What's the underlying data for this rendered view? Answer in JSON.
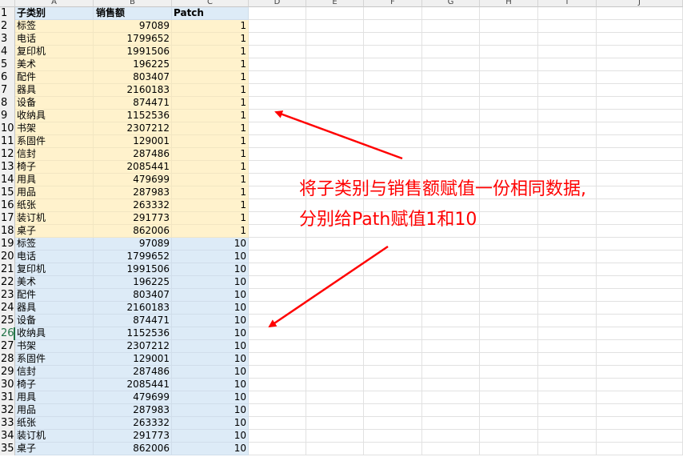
{
  "columns": [
    "A",
    "B",
    "C",
    "D",
    "E",
    "F",
    "G",
    "H",
    "I",
    "J"
  ],
  "headers": [
    "子类别",
    "销售额",
    "Patch"
  ],
  "rows": [
    [
      "标签",
      "97089",
      "1"
    ],
    [
      "电话",
      "1799652",
      "1"
    ],
    [
      "复印机",
      "1991506",
      "1"
    ],
    [
      "美术",
      "196225",
      "1"
    ],
    [
      "配件",
      "803407",
      "1"
    ],
    [
      "器具",
      "2160183",
      "1"
    ],
    [
      "设备",
      "874471",
      "1"
    ],
    [
      "收纳具",
      "1152536",
      "1"
    ],
    [
      "书架",
      "2307212",
      "1"
    ],
    [
      "系固件",
      "129001",
      "1"
    ],
    [
      "信封",
      "287486",
      "1"
    ],
    [
      "椅子",
      "2085441",
      "1"
    ],
    [
      "用具",
      "479699",
      "1"
    ],
    [
      "用品",
      "287983",
      "1"
    ],
    [
      "纸张",
      "263332",
      "1"
    ],
    [
      "装订机",
      "291773",
      "1"
    ],
    [
      "桌子",
      "862006",
      "1"
    ],
    [
      "标签",
      "97089",
      "10"
    ],
    [
      "电话",
      "1799652",
      "10"
    ],
    [
      "复印机",
      "1991506",
      "10"
    ],
    [
      "美术",
      "196225",
      "10"
    ],
    [
      "配件",
      "803407",
      "10"
    ],
    [
      "器具",
      "2160183",
      "10"
    ],
    [
      "设备",
      "874471",
      "10"
    ],
    [
      "收纳具",
      "1152536",
      "10"
    ],
    [
      "书架",
      "2307212",
      "10"
    ],
    [
      "系固件",
      "129001",
      "10"
    ],
    [
      "信封",
      "287486",
      "10"
    ],
    [
      "椅子",
      "2085441",
      "10"
    ],
    [
      "用具",
      "479699",
      "10"
    ],
    [
      "用品",
      "287983",
      "10"
    ],
    [
      "纸张",
      "263332",
      "10"
    ],
    [
      "装订机",
      "291773",
      "10"
    ],
    [
      "桌子",
      "862006",
      "10"
    ]
  ],
  "active_row": 26,
  "annotation": {
    "line1": "将子类别与销售额赋值一份相同数据,",
    "line2": "分别给Path赋值1和10"
  },
  "colors": {
    "fill_patch1": "#fff2cc",
    "fill_patch10": "#ddebf7",
    "annotation": "#ff0000"
  }
}
